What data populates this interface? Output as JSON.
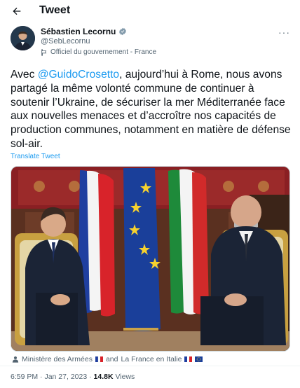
{
  "header": {
    "title": "Tweet",
    "back_icon": "arrow-left-icon"
  },
  "author": {
    "name": "Sébastien Lecornu",
    "handle": "@SebLecornu",
    "affiliation": "Officiel du gouvernement - France",
    "verified_icon": "verified-badge-icon",
    "more_icon": "more-horizontal-icon",
    "more_label": "···"
  },
  "tweet": {
    "text_before": "Avec ",
    "mention": "@GuidoCrosetto",
    "text_after": ", aujourd’hui à Rome, nous avons partagé la même volonté commune de continuer à soutenir l’Ukraine, de sécuriser la mer Méditerranée face aux nouvelles menaces et d’accroître nos capacités de production communes, notamment en matière de défense sol-air.",
    "translate_label": "Translate Tweet"
  },
  "tags": {
    "first": "Ministère des Armées",
    "joiner": "and",
    "second": "La France en Italie"
  },
  "meta": {
    "time": "6:59 PM",
    "separator": "·",
    "date": "Jan 27, 2023",
    "views_count": "14.8K",
    "views_label": "Views"
  },
  "colors": {
    "accent": "#1d9bf0",
    "muted": "#536471",
    "text": "#0f1419"
  }
}
